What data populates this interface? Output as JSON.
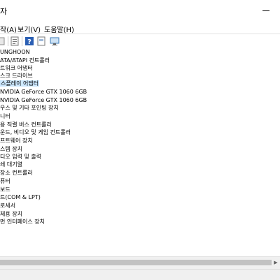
{
  "window": {
    "title_fragment": "자",
    "minimize_icon": "minimize-icon"
  },
  "menu": {
    "items": [
      {
        "label": "작(A)"
      },
      {
        "label": "보기(V)"
      },
      {
        "label": "도움말(H)"
      }
    ]
  },
  "toolbar": {
    "icons": [
      "properties-icon",
      "help-icon",
      "monitor-icon"
    ]
  },
  "tree": {
    "items": [
      {
        "label": "UNGHOON"
      },
      {
        "label": " ATA/ATAPI 컨트롤러"
      },
      {
        "label": "트워크 어댑터"
      },
      {
        "label": "스크 드라이브"
      },
      {
        "label": "스플레이 어댑터",
        "selected": true
      },
      {
        "label": "NVIDIA GeForce GTX 1060 6GB"
      },
      {
        "label": "NVIDIA GeForce GTX 1060 6GB"
      },
      {
        "label": "우스 및 기타 포인팅 장치"
      },
      {
        "label": "니터"
      },
      {
        "label": "용 직렬 버스 컨트롤러"
      },
      {
        "label": "운드, 비디오 및 게임 컨트롤러"
      },
      {
        "label": "프트웨어 장치"
      },
      {
        "label": "스템 장치"
      },
      {
        "label": "디오 입력 및 출력"
      },
      {
        "label": "쇄 대기열"
      },
      {
        "label": "장소 컨트롤러"
      },
      {
        "label": "퓨터"
      },
      {
        "label": "보드"
      },
      {
        "label": "트(COM & LPT)"
      },
      {
        "label": "로세서"
      },
      {
        "label": "체용 장치"
      },
      {
        "label": "먼 인터페이스 장치"
      }
    ]
  },
  "colors": {
    "selection": "#cce8ff",
    "help_icon": "#2b5fb4"
  }
}
